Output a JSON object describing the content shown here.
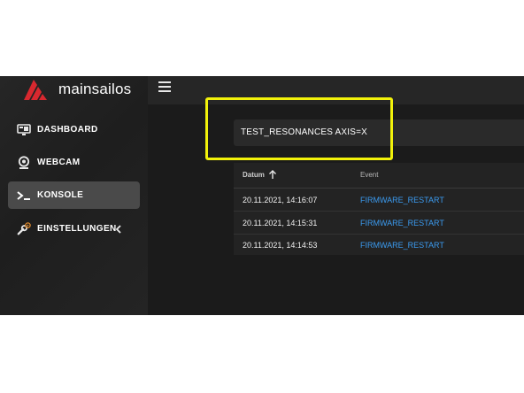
{
  "brand": {
    "name": "mainsailos",
    "logo_icon": "mainsail-logo-icon",
    "logo_color": "#d9282f"
  },
  "sidebar": {
    "items": [
      {
        "label": "DASHBOARD",
        "icon": "monitor-icon",
        "active": false
      },
      {
        "label": "WEBCAM",
        "icon": "webcam-icon",
        "active": false
      },
      {
        "label": "KONSOLE",
        "icon": "console-icon",
        "active": true
      },
      {
        "label": "EINSTELLUNGEN",
        "icon": "wrench-gear-icon",
        "active": false,
        "expandable": true
      }
    ]
  },
  "topbar": {
    "menu_icon": "hamburger-menu-icon"
  },
  "console": {
    "command": "TEST_RESONANCES AXIS=X"
  },
  "history": {
    "columns": {
      "date": "Datum",
      "event": "Event",
      "sort": "ascending-arrow"
    },
    "rows": [
      {
        "date": "20.11.2021, 14:16:07",
        "event": "FIRMWARE_RESTART"
      },
      {
        "date": "20.11.2021, 14:15:31",
        "event": "FIRMWARE_RESTART"
      },
      {
        "date": "20.11.2021, 14:14:53",
        "event": "FIRMWARE_RESTART"
      }
    ]
  },
  "colors": {
    "highlight": "#f2f20a",
    "link": "#3b9bf0",
    "active_nav": "#4a4a4a"
  }
}
